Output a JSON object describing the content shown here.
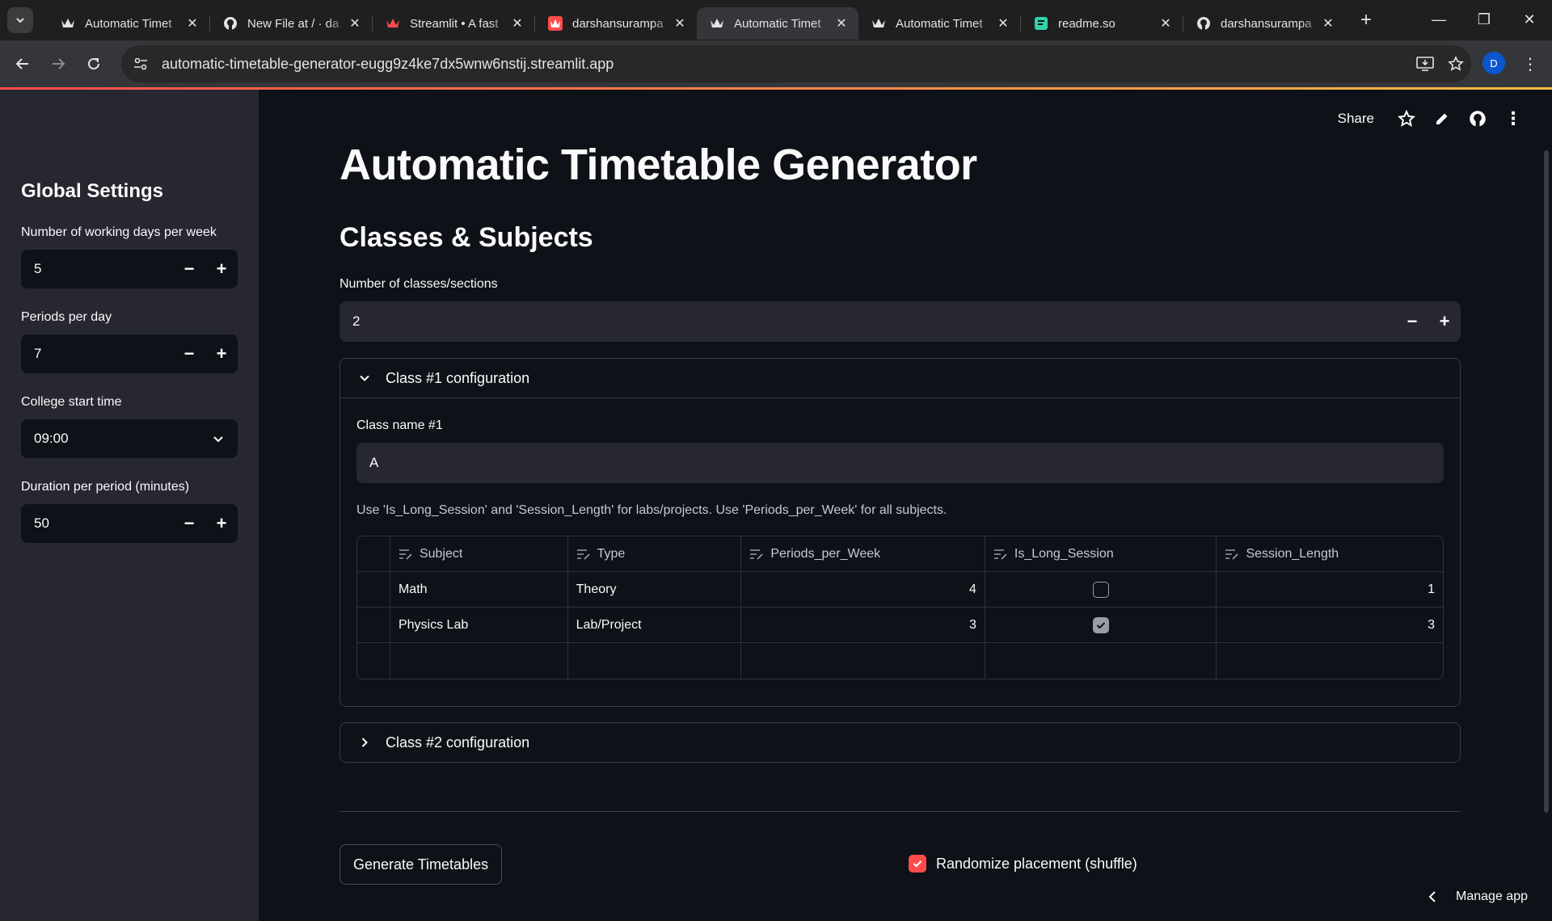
{
  "browser": {
    "tabs": [
      {
        "title": "Automatic Timet",
        "icon": "streamlit-crown-icon",
        "active": false
      },
      {
        "title": "New File at / · da",
        "icon": "github-icon",
        "active": false
      },
      {
        "title": "Streamlit • A fast",
        "icon": "streamlit-crown-icon",
        "active": false
      },
      {
        "title": "darshansurampa",
        "icon": "streamlit-app-icon",
        "active": false
      },
      {
        "title": "Automatic Timet",
        "icon": "streamlit-crown-icon",
        "active": true
      },
      {
        "title": "Automatic Timet",
        "icon": "streamlit-crown-icon",
        "active": false
      },
      {
        "title": "readme.so",
        "icon": "readme-icon",
        "active": false
      },
      {
        "title": "darshansurampa",
        "icon": "github-icon",
        "active": false
      }
    ],
    "url": "automatic-timetable-generator-eugg9z4ke7dx5wnw6nstij.streamlit.app",
    "profile_initial": "D"
  },
  "sidebar": {
    "title": "Global Settings",
    "working_days": {
      "label": "Number of working days per week",
      "value": "5"
    },
    "periods_per_day": {
      "label": "Periods per day",
      "value": "7"
    },
    "start_time": {
      "label": "College start time",
      "value": "09:00"
    },
    "duration": {
      "label": "Duration per period (minutes)",
      "value": "50"
    }
  },
  "toolbar": {
    "share_label": "Share"
  },
  "main": {
    "title": "Automatic Timetable Generator",
    "section_title": "Classes & Subjects",
    "num_classes": {
      "label": "Number of classes/sections",
      "value": "2"
    },
    "class1": {
      "header": "Class #1 configuration",
      "name_label": "Class name #1",
      "name_value": "A",
      "caption": "Use 'Is_Long_Session' and 'Session_Length' for labs/projects. Use 'Periods_per_Week' for all subjects.",
      "columns": [
        "Subject",
        "Type",
        "Periods_per_Week",
        "Is_Long_Session",
        "Session_Length"
      ],
      "rows": [
        {
          "subject": "Math",
          "type": "Theory",
          "periods": "4",
          "long": false,
          "length": "1"
        },
        {
          "subject": "Physics Lab",
          "type": "Lab/Project",
          "periods": "3",
          "long": true,
          "length": "3"
        }
      ]
    },
    "class2": {
      "header": "Class #2 configuration"
    },
    "generate_label": "Generate Timetables",
    "randomize_label": "Randomize placement (shuffle)",
    "randomize_checked": true,
    "manage_label": "Manage app"
  },
  "colors": {
    "accent": "#ff4b4b",
    "background": "#0e1117",
    "sidebar": "#262730"
  }
}
